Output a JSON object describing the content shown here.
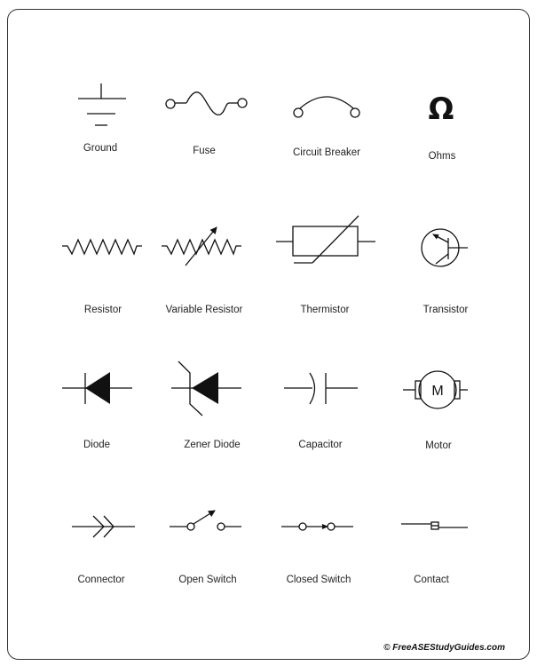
{
  "symbols": [
    {
      "label": "Ground",
      "icon": "ground-icon"
    },
    {
      "label": "Fuse",
      "icon": "fuse-icon"
    },
    {
      "label": "Circuit Breaker",
      "icon": "circuit-breaker-icon"
    },
    {
      "label": "Ohms",
      "icon": "ohms-icon",
      "glyph": "Ω"
    },
    {
      "label": "Resistor",
      "icon": "resistor-icon"
    },
    {
      "label": "Variable Resistor",
      "icon": "variable-resistor-icon"
    },
    {
      "label": "Thermistor",
      "icon": "thermistor-icon"
    },
    {
      "label": "Transistor",
      "icon": "transistor-icon"
    },
    {
      "label": "Diode",
      "icon": "diode-icon"
    },
    {
      "label": "Zener Diode",
      "icon": "zener-diode-icon"
    },
    {
      "label": "Capacitor",
      "icon": "capacitor-icon"
    },
    {
      "label": "Motor",
      "icon": "motor-icon",
      "glyph": "M"
    },
    {
      "label": "Connector",
      "icon": "connector-icon"
    },
    {
      "label": "Open Switch",
      "icon": "open-switch-icon"
    },
    {
      "label": "Closed Switch",
      "icon": "closed-switch-icon"
    },
    {
      "label": "Contact",
      "icon": "contact-icon"
    }
  ],
  "copyright": "© FreeASEStudyGuides.com"
}
